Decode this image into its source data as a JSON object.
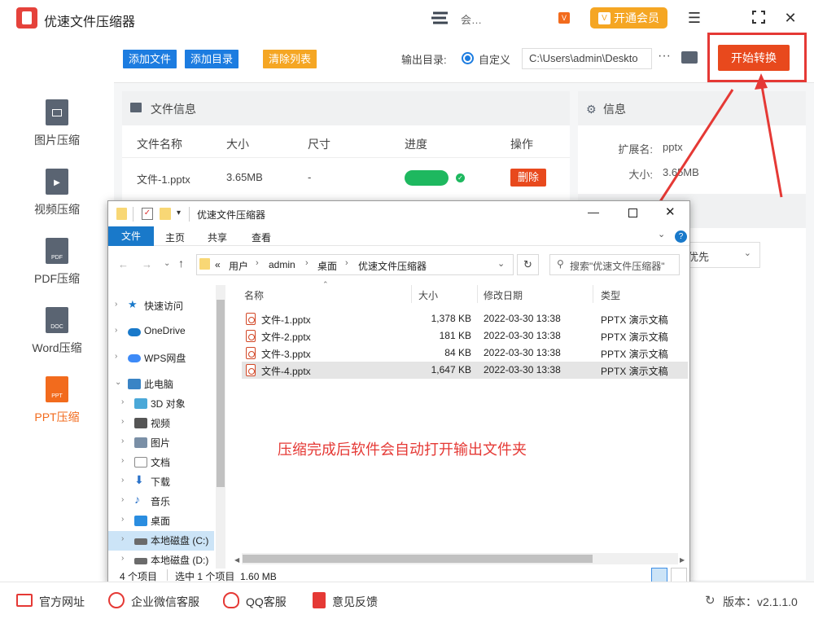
{
  "app": {
    "title": "优速文件压缩器",
    "user_name": "会…",
    "vip_badge": "V",
    "vip_button_label": "开通会员"
  },
  "window_controls": {
    "menu": "☰",
    "maximize": "⛶",
    "close": "✕"
  },
  "sidebar": {
    "items": [
      {
        "label": "图片压缩",
        "icon": "image-file-icon",
        "badge": ""
      },
      {
        "label": "视频压缩",
        "icon": "video-file-icon",
        "badge": "▶"
      },
      {
        "label": "PDF压缩",
        "icon": "pdf-file-icon",
        "badge": "PDF"
      },
      {
        "label": "Word压缩",
        "icon": "doc-file-icon",
        "badge": "DOC"
      },
      {
        "label": "PPT压缩",
        "icon": "ppt-file-icon",
        "badge": "PPT",
        "active": true
      }
    ]
  },
  "toolbar": {
    "add_file": "添加文件",
    "add_dir": "添加目录",
    "clear_list": "清除列表",
    "output_label": "输出目录:",
    "radio_label": "自定义",
    "output_path": "C:\\Users\\admin\\Deskto",
    "more": "···",
    "start": "开始转换"
  },
  "file_panel": {
    "title": "文件信息",
    "columns": [
      "文件名称",
      "大小",
      "尺寸",
      "进度",
      "操作"
    ],
    "rows": [
      {
        "name": "文件-1.pptx",
        "size": "3.65MB",
        "dimension": "-",
        "progress": 1.0,
        "action": "删除"
      }
    ]
  },
  "info_panel": {
    "title": "信息",
    "ext_label": "扩展名:",
    "ext_value": "pptx",
    "size_label": "大小:",
    "size_value": "3.65MB",
    "priority_value": "优先"
  },
  "explorer": {
    "title": "优速文件压缩器",
    "tabs": [
      "文件",
      "主页",
      "共享",
      "查看"
    ],
    "breadcrumb": [
      "«",
      "用户",
      "admin",
      "桌面",
      "优速文件压缩器"
    ],
    "search_placeholder": "搜索\"优速文件压缩器\"",
    "nav": [
      {
        "label": "快速访问",
        "icon": "star-icon",
        "color": "#1979ca",
        "expanded": false
      },
      {
        "label": "OneDrive",
        "icon": "cloud-icon",
        "color": "#1979ca",
        "expanded": false
      },
      {
        "label": "WPS网盘",
        "icon": "cloud-icon",
        "color": "#3d8af7",
        "expanded": false
      },
      {
        "label": "此电脑",
        "icon": "computer-icon",
        "color": "#3a84c5",
        "expanded": true
      },
      {
        "label": "3D 对象",
        "icon": "cube-icon",
        "color": "#4aa8d8"
      },
      {
        "label": "视频",
        "icon": "film-icon",
        "color": "#555555"
      },
      {
        "label": "图片",
        "icon": "picture-icon",
        "color": "#7a8fa6"
      },
      {
        "label": "文档",
        "icon": "document-icon",
        "color": "#8a8a8a"
      },
      {
        "label": "下载",
        "icon": "download-icon",
        "color": "#2a72c9"
      },
      {
        "label": "音乐",
        "icon": "music-icon",
        "color": "#2a72c9"
      },
      {
        "label": "桌面",
        "icon": "desktop-icon",
        "color": "#2a8de0"
      },
      {
        "label": "本地磁盘 (C:)",
        "icon": "drive-icon",
        "color": "#6b6b6b",
        "selected": true
      },
      {
        "label": "本地磁盘 (D:)",
        "icon": "drive-icon",
        "color": "#6b6b6b"
      }
    ],
    "columns": [
      "名称",
      "大小",
      "修改日期",
      "类型"
    ],
    "files": [
      {
        "name": "文件-1.pptx",
        "size": "1,378 KB",
        "date": "2022-03-30 13:38",
        "type": "PPTX 演示文稿"
      },
      {
        "name": "文件-2.pptx",
        "size": "181 KB",
        "date": "2022-03-30 13:38",
        "type": "PPTX 演示文稿"
      },
      {
        "name": "文件-3.pptx",
        "size": "84 KB",
        "date": "2022-03-30 13:38",
        "type": "PPTX 演示文稿"
      },
      {
        "name": "文件-4.pptx",
        "size": "1,647 KB",
        "date": "2022-03-30 13:38",
        "type": "PPTX 演示文稿",
        "selected": true
      }
    ],
    "status_items": "4 个项目",
    "status_selected": "选中 1 个项目  1.60 MB",
    "annotation": "压缩完成后软件会自动打开输出文件夹"
  },
  "footer": {
    "website": "官方网址",
    "wechat": "企业微信客服",
    "qq": "QQ客服",
    "feedback": "意见反馈",
    "version": "版本：v2.1.1.0"
  },
  "colors": {
    "accent": "#e8491d",
    "blue_button": "#1c7ce0",
    "orange_button": "#f5a623",
    "red_annotation": "#e53935"
  }
}
